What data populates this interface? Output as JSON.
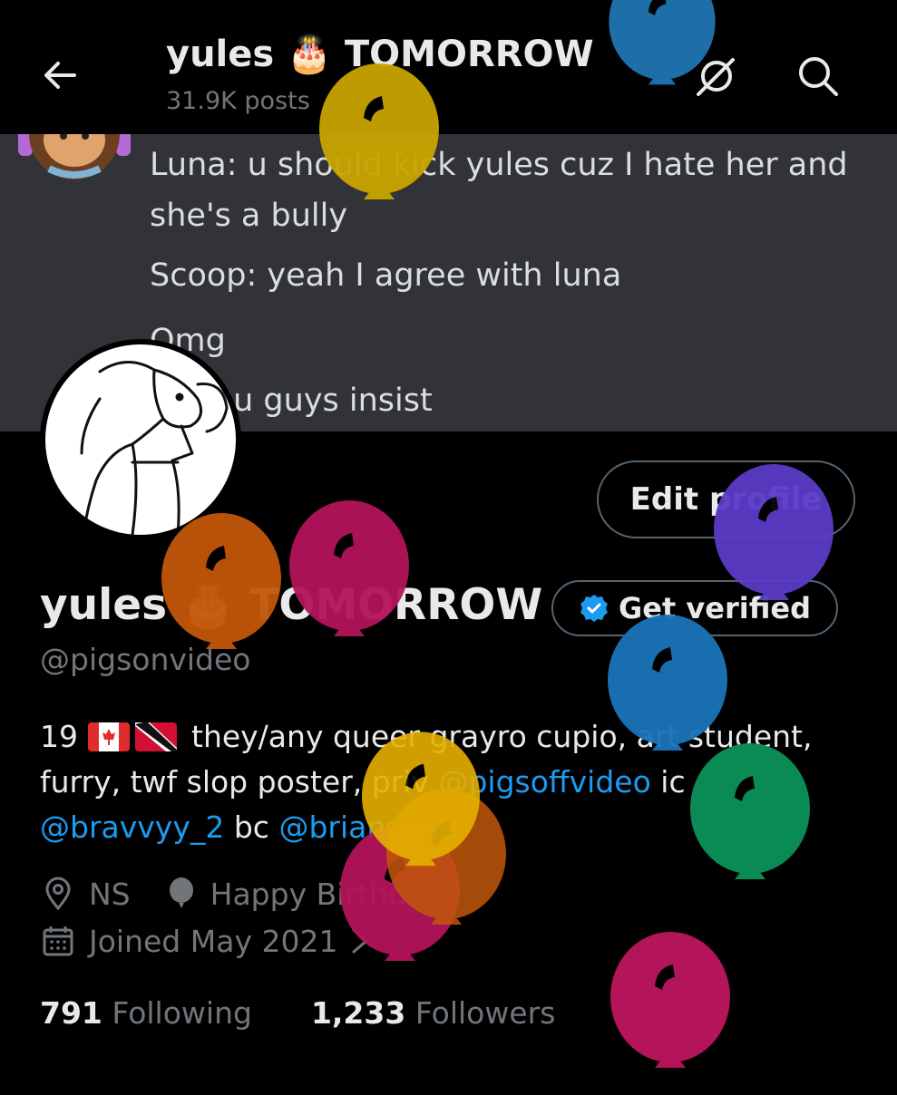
{
  "header": {
    "name": "yules 🎂 TOMORROW",
    "post_count": "31.9K posts"
  },
  "banner": {
    "lines": [
      "Luna: u should kick yules cuz I hate her and",
      "she's a bully",
      "Scoop: yeah I agree with luna",
      "Omg",
      "Ok if u guys insist"
    ]
  },
  "profile": {
    "display_name": "yules 🎂 TOMORROW",
    "edit_label": "Edit profile",
    "get_verified_label": "Get verified",
    "handle": "@pigsonvideo",
    "bio": {
      "prefix": "19",
      "text1": "they/any queer grayro cupio, art student,",
      "text2": "furry, twf slop poster, priv",
      "link1": "@pigsoffvideo",
      "text3": "ic",
      "link2": "@bravvyy_2",
      "text4": "bc",
      "link3": "@brianstells"
    },
    "location": "NS",
    "birthday": "Happy Birthday!",
    "joined": "Joined May 2021",
    "following_count": "791",
    "following_label": "Following",
    "followers_count": "1,233",
    "followers_label": "Followers"
  },
  "icons": {
    "back": "arrow-left-icon",
    "grok": "grok-icon",
    "search": "search-icon",
    "verified": "verified-badge-icon",
    "location": "location-pin-icon",
    "balloon": "balloon-icon",
    "calendar": "calendar-icon"
  },
  "colors": {
    "accent": "#1d9bf0",
    "text_secondary": "#71767b",
    "banner_bg": "#313338",
    "balloons": [
      "#1e6ea8",
      "#c9a400",
      "#c2570a",
      "#b3145a",
      "#5b3bc8",
      "#1a74b8",
      "#0a8a55",
      "#e6b000"
    ]
  }
}
